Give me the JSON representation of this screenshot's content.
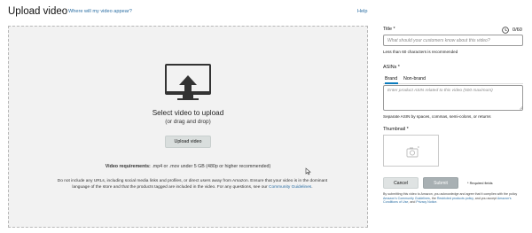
{
  "header": {
    "title": "Upload video",
    "help_question": "Where will my video appear?",
    "help_label": "Help"
  },
  "dropzone": {
    "title": "Select video to upload",
    "subtitle": "(or drag and drop)",
    "upload_button": "Upload video",
    "requirements_label": "Video requirements:",
    "requirements_text": ".mp4 or .mov under 5 GB (480p or higher recommended)",
    "policy_text": "Do not include any URLs, including social media links and profiles, or direct users away from Amazon. Ensure that your video is in the dominant language of the store and that the products tagged are included in the video. For any questions, see our",
    "policy_link": "Community Guidelines",
    "policy_end": "."
  },
  "form": {
    "title_label": "Title *",
    "title_counter": "0/60",
    "title_placeholder": "What should your customers know about this video?",
    "title_hint": "Less than 60 characters is recommended",
    "asins_label": "ASINs *",
    "tabs": [
      {
        "label": "Brand",
        "active": true
      },
      {
        "label": "Non-brand",
        "active": false
      }
    ],
    "asin_placeholder": "Enter product ASIN related to this video (500 maximum)",
    "asin_note": "Separate ASIN by spaces, commas, semi-colons, or returns",
    "thumbnail_label": "Thumbnail *",
    "cancel_label": "Cancel",
    "submit_label": "Submit",
    "required_note": "* Required fields",
    "legal_1": "By submitting this video to Amazon, you acknowledge and agree that it complies with the policy",
    "legal_link_1": "Amazon's Community Guidelines",
    "legal_2": ", the",
    "legal_link_2": "Restricted products policy",
    "legal_3": ", and you accept",
    "legal_link_3": "Amazon's Conditions of Use",
    "legal_4": ", and",
    "legal_link_4": "Privacy Notice",
    "legal_5": "."
  },
  "colors": {
    "link": "#2b6ea3",
    "tab_accent": "#0a7bbd",
    "submit_disabled": "#a8b0b3"
  },
  "icons": [
    "upload-monitor-icon",
    "clock-icon",
    "camera-icon",
    "mouse-cursor-icon",
    "resize-grip-icon"
  ]
}
